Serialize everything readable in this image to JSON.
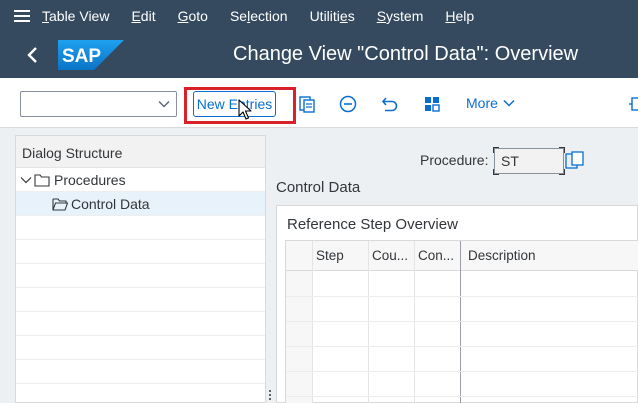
{
  "menu": {
    "items": [
      {
        "pre": "",
        "ul": "T",
        "post": "able View"
      },
      {
        "pre": "",
        "ul": "E",
        "post": "dit"
      },
      {
        "pre": "",
        "ul": "G",
        "post": "oto"
      },
      {
        "pre": "Se",
        "ul": "l",
        "post": "ection"
      },
      {
        "pre": "Utiliti",
        "ul": "e",
        "post": "s"
      },
      {
        "pre": "",
        "ul": "S",
        "post": "ystem"
      },
      {
        "pre": "",
        "ul": "H",
        "post": "elp"
      }
    ]
  },
  "header": {
    "logo_text": "SAP",
    "title": "Change View \"Control Data\": Overview"
  },
  "toolbar": {
    "new_entries_label": "New Entries",
    "more_label": "More"
  },
  "dialog_structure": {
    "title": "Dialog Structure",
    "items": [
      {
        "label": "Procedures"
      },
      {
        "label": "Control Data"
      }
    ]
  },
  "procedure": {
    "label": "Procedure:",
    "value": "ST"
  },
  "section_title": "Control Data",
  "reference_steps": {
    "title": "Reference Step Overview",
    "columns": [
      "Step",
      "Cou...",
      "Con...",
      "Description"
    ]
  },
  "colors": {
    "shell": "#354a5f",
    "accent": "#0a6ed1",
    "highlight": "#d9212a",
    "selected_row": "#e8f2fb"
  }
}
